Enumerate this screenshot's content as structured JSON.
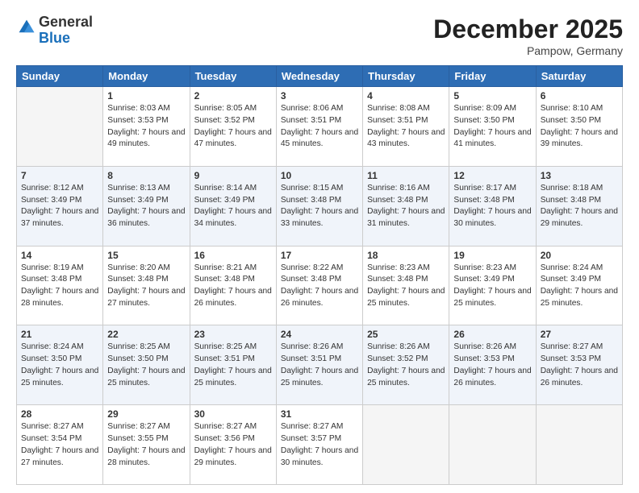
{
  "header": {
    "logo": {
      "line1": "General",
      "line2": "Blue"
    },
    "title": "December 2025",
    "location": "Pampow, Germany"
  },
  "days_of_week": [
    "Sunday",
    "Monday",
    "Tuesday",
    "Wednesday",
    "Thursday",
    "Friday",
    "Saturday"
  ],
  "weeks": [
    [
      {
        "num": "",
        "sunrise": "",
        "sunset": "",
        "daylight": ""
      },
      {
        "num": "1",
        "sunrise": "Sunrise: 8:03 AM",
        "sunset": "Sunset: 3:53 PM",
        "daylight": "Daylight: 7 hours and 49 minutes."
      },
      {
        "num": "2",
        "sunrise": "Sunrise: 8:05 AM",
        "sunset": "Sunset: 3:52 PM",
        "daylight": "Daylight: 7 hours and 47 minutes."
      },
      {
        "num": "3",
        "sunrise": "Sunrise: 8:06 AM",
        "sunset": "Sunset: 3:51 PM",
        "daylight": "Daylight: 7 hours and 45 minutes."
      },
      {
        "num": "4",
        "sunrise": "Sunrise: 8:08 AM",
        "sunset": "Sunset: 3:51 PM",
        "daylight": "Daylight: 7 hours and 43 minutes."
      },
      {
        "num": "5",
        "sunrise": "Sunrise: 8:09 AM",
        "sunset": "Sunset: 3:50 PM",
        "daylight": "Daylight: 7 hours and 41 minutes."
      },
      {
        "num": "6",
        "sunrise": "Sunrise: 8:10 AM",
        "sunset": "Sunset: 3:50 PM",
        "daylight": "Daylight: 7 hours and 39 minutes."
      }
    ],
    [
      {
        "num": "7",
        "sunrise": "Sunrise: 8:12 AM",
        "sunset": "Sunset: 3:49 PM",
        "daylight": "Daylight: 7 hours and 37 minutes."
      },
      {
        "num": "8",
        "sunrise": "Sunrise: 8:13 AM",
        "sunset": "Sunset: 3:49 PM",
        "daylight": "Daylight: 7 hours and 36 minutes."
      },
      {
        "num": "9",
        "sunrise": "Sunrise: 8:14 AM",
        "sunset": "Sunset: 3:49 PM",
        "daylight": "Daylight: 7 hours and 34 minutes."
      },
      {
        "num": "10",
        "sunrise": "Sunrise: 8:15 AM",
        "sunset": "Sunset: 3:48 PM",
        "daylight": "Daylight: 7 hours and 33 minutes."
      },
      {
        "num": "11",
        "sunrise": "Sunrise: 8:16 AM",
        "sunset": "Sunset: 3:48 PM",
        "daylight": "Daylight: 7 hours and 31 minutes."
      },
      {
        "num": "12",
        "sunrise": "Sunrise: 8:17 AM",
        "sunset": "Sunset: 3:48 PM",
        "daylight": "Daylight: 7 hours and 30 minutes."
      },
      {
        "num": "13",
        "sunrise": "Sunrise: 8:18 AM",
        "sunset": "Sunset: 3:48 PM",
        "daylight": "Daylight: 7 hours and 29 minutes."
      }
    ],
    [
      {
        "num": "14",
        "sunrise": "Sunrise: 8:19 AM",
        "sunset": "Sunset: 3:48 PM",
        "daylight": "Daylight: 7 hours and 28 minutes."
      },
      {
        "num": "15",
        "sunrise": "Sunrise: 8:20 AM",
        "sunset": "Sunset: 3:48 PM",
        "daylight": "Daylight: 7 hours and 27 minutes."
      },
      {
        "num": "16",
        "sunrise": "Sunrise: 8:21 AM",
        "sunset": "Sunset: 3:48 PM",
        "daylight": "Daylight: 7 hours and 26 minutes."
      },
      {
        "num": "17",
        "sunrise": "Sunrise: 8:22 AM",
        "sunset": "Sunset: 3:48 PM",
        "daylight": "Daylight: 7 hours and 26 minutes."
      },
      {
        "num": "18",
        "sunrise": "Sunrise: 8:23 AM",
        "sunset": "Sunset: 3:48 PM",
        "daylight": "Daylight: 7 hours and 25 minutes."
      },
      {
        "num": "19",
        "sunrise": "Sunrise: 8:23 AM",
        "sunset": "Sunset: 3:49 PM",
        "daylight": "Daylight: 7 hours and 25 minutes."
      },
      {
        "num": "20",
        "sunrise": "Sunrise: 8:24 AM",
        "sunset": "Sunset: 3:49 PM",
        "daylight": "Daylight: 7 hours and 25 minutes."
      }
    ],
    [
      {
        "num": "21",
        "sunrise": "Sunrise: 8:24 AM",
        "sunset": "Sunset: 3:50 PM",
        "daylight": "Daylight: 7 hours and 25 minutes."
      },
      {
        "num": "22",
        "sunrise": "Sunrise: 8:25 AM",
        "sunset": "Sunset: 3:50 PM",
        "daylight": "Daylight: 7 hours and 25 minutes."
      },
      {
        "num": "23",
        "sunrise": "Sunrise: 8:25 AM",
        "sunset": "Sunset: 3:51 PM",
        "daylight": "Daylight: 7 hours and 25 minutes."
      },
      {
        "num": "24",
        "sunrise": "Sunrise: 8:26 AM",
        "sunset": "Sunset: 3:51 PM",
        "daylight": "Daylight: 7 hours and 25 minutes."
      },
      {
        "num": "25",
        "sunrise": "Sunrise: 8:26 AM",
        "sunset": "Sunset: 3:52 PM",
        "daylight": "Daylight: 7 hours and 25 minutes."
      },
      {
        "num": "26",
        "sunrise": "Sunrise: 8:26 AM",
        "sunset": "Sunset: 3:53 PM",
        "daylight": "Daylight: 7 hours and 26 minutes."
      },
      {
        "num": "27",
        "sunrise": "Sunrise: 8:27 AM",
        "sunset": "Sunset: 3:53 PM",
        "daylight": "Daylight: 7 hours and 26 minutes."
      }
    ],
    [
      {
        "num": "28",
        "sunrise": "Sunrise: 8:27 AM",
        "sunset": "Sunset: 3:54 PM",
        "daylight": "Daylight: 7 hours and 27 minutes."
      },
      {
        "num": "29",
        "sunrise": "Sunrise: 8:27 AM",
        "sunset": "Sunset: 3:55 PM",
        "daylight": "Daylight: 7 hours and 28 minutes."
      },
      {
        "num": "30",
        "sunrise": "Sunrise: 8:27 AM",
        "sunset": "Sunset: 3:56 PM",
        "daylight": "Daylight: 7 hours and 29 minutes."
      },
      {
        "num": "31",
        "sunrise": "Sunrise: 8:27 AM",
        "sunset": "Sunset: 3:57 PM",
        "daylight": "Daylight: 7 hours and 30 minutes."
      },
      {
        "num": "",
        "sunrise": "",
        "sunset": "",
        "daylight": ""
      },
      {
        "num": "",
        "sunrise": "",
        "sunset": "",
        "daylight": ""
      },
      {
        "num": "",
        "sunrise": "",
        "sunset": "",
        "daylight": ""
      }
    ]
  ]
}
